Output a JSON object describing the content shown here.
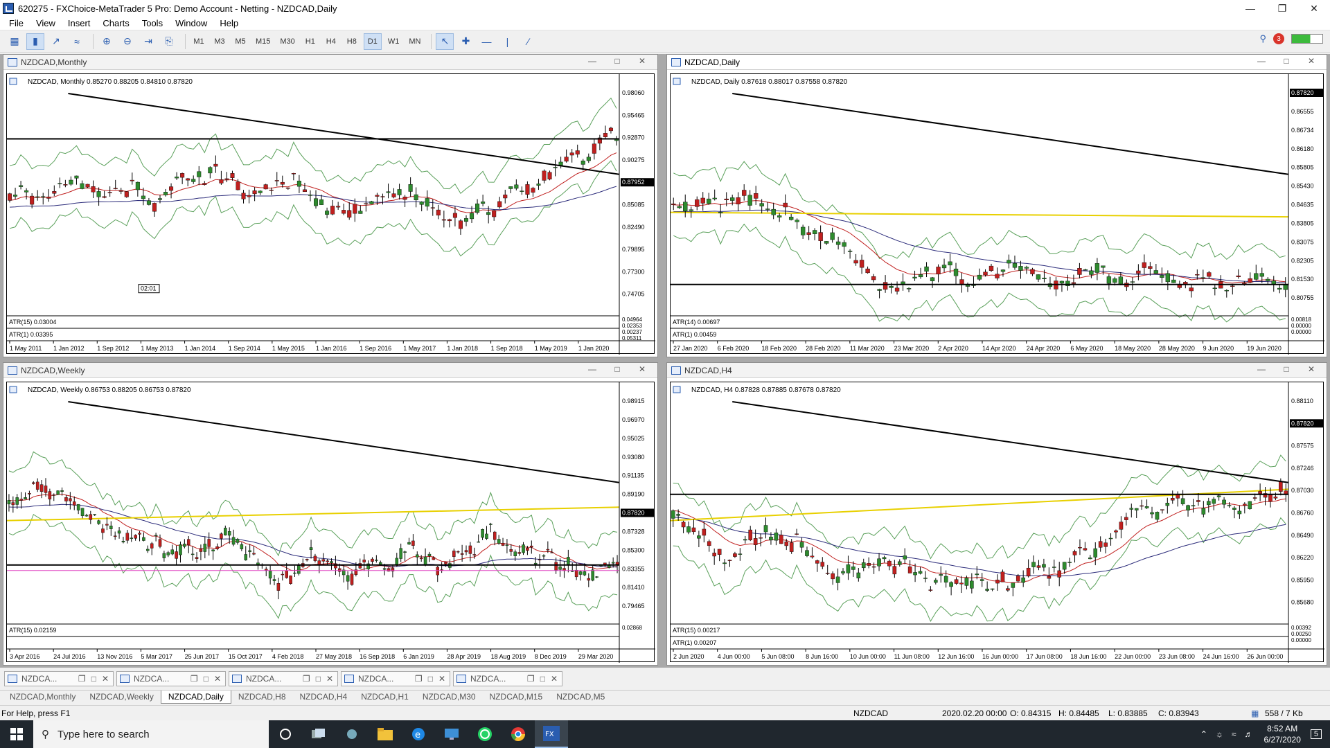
{
  "app": {
    "title": "620275 - FXChoice-MetaTrader 5 Pro: Demo Account - Netting - NZDCAD,Daily"
  },
  "menu": [
    "File",
    "View",
    "Insert",
    "Charts",
    "Tools",
    "Window",
    "Help"
  ],
  "timeframes": [
    "M1",
    "M3",
    "M5",
    "M15",
    "M30",
    "H1",
    "H4",
    "H8",
    "D1",
    "W1",
    "MN"
  ],
  "active_timeframe": "D1",
  "notifications": "3",
  "windows": [
    {
      "title": "NZDCAD,Monthly",
      "info": "NZDCAD, Monthly  0.85270 0.88205 0.84810 0.87820",
      "price_labels": [
        "0.98060",
        "0.95465",
        "0.92870",
        "0.90275",
        "0.87952",
        "0.85085",
        "0.82490",
        "0.79895",
        "0.77300",
        "0.74705"
      ],
      "current": "0.87952",
      "atr1": "ATR(15) 0.03004",
      "atr2": "ATR(1) 0.03395",
      "atr_labels": [
        "0.04964",
        "0.02353",
        "0.00237",
        "0.05311"
      ],
      "dates": [
        "1 May 2011",
        "1 Jan 2012",
        "1 Sep 2012",
        "1 May 2013",
        "1 Jan 2014",
        "1 Sep 2014",
        "1 May 2015",
        "1 Jan 2016",
        "1 Sep 2016",
        "1 May 2017",
        "1 Jan 2018",
        "1 Sep 2018",
        "1 May 2019",
        "1 Jan 2020"
      ],
      "timer": "02:01",
      "seed": 11,
      "n": 110
    },
    {
      "title": "NZDCAD,Daily",
      "info": "NZDCAD, Daily  0.87618 0.88017 0.87558 0.87820",
      "price_labels": [
        "0.87820",
        "0.86555",
        "0.86734",
        "0.86180",
        "0.85805",
        "0.85430",
        "0.84635",
        "0.83805",
        "0.83075",
        "0.82305",
        "0.81530",
        "0.80755"
      ],
      "current": "0.87820",
      "atr1": "ATR(14) 0.00697",
      "atr2": "ATR(1) 0.00459",
      "atr_labels": [
        "0.00818",
        "0.00000",
        "0.00000"
      ],
      "dates": [
        "27 Jan 2020",
        "6 Feb 2020",
        "18 Feb 2020",
        "28 Feb 2020",
        "11 Mar 2020",
        "23 Mar 2020",
        "2 Apr 2020",
        "14 Apr 2020",
        "24 Apr 2020",
        "6 May 2020",
        "18 May 2020",
        "28 May 2020",
        "9 Jun 2020",
        "19 Jun 2020"
      ],
      "seed": 23,
      "n": 105
    },
    {
      "title": "NZDCAD,Weekly",
      "info": "NZDCAD, Weekly  0.86753 0.88205 0.86753 0.87820",
      "price_labels": [
        "0.98915",
        "0.96970",
        "0.95025",
        "0.93080",
        "0.91135",
        "0.89190",
        "0.87820",
        "0.87328",
        "0.85300",
        "0.83355",
        "0.81410",
        "0.79465"
      ],
      "current": "0.87820",
      "atr1": "ATR(15) 0.02159",
      "atr2": "",
      "atr_labels": [
        "0.02868"
      ],
      "dates": [
        "3 Apr 2016",
        "24 Jul 2016",
        "13 Nov 2016",
        "5 Mar 2017",
        "25 Jun 2017",
        "15 Oct 2017",
        "4 Feb 2018",
        "27 May 2018",
        "16 Sep 2018",
        "6 Jan 2019",
        "28 Apr 2019",
        "18 Aug 2019",
        "8 Dec 2019",
        "29 Mar 2020"
      ],
      "seed": 37,
      "n": 150
    },
    {
      "title": "NZDCAD,H4",
      "info": "NZDCAD, H4  0.87828 0.87885 0.87678 0.87820",
      "price_labels": [
        "0.88110",
        "0.87820",
        "0.87575",
        "0.87246",
        "0.87030",
        "0.86760",
        "0.86490",
        "0.86220",
        "0.85950",
        "0.85680"
      ],
      "current": "0.87820",
      "atr1": "ATR(15) 0.00217",
      "atr2": "ATR(1) 0.00207",
      "atr_labels": [
        "0.00392",
        "0.00250",
        "0.00000"
      ],
      "dates": [
        "2 Jun 2020",
        "4 Jun 00:00",
        "5 Jun 08:00",
        "8 Jun 16:00",
        "10 Jun 00:00",
        "11 Jun 08:00",
        "12 Jun 16:00",
        "16 Jun 00:00",
        "17 Jun 08:00",
        "18 Jun 16:00",
        "22 Jun 00:00",
        "23 Jun 08:00",
        "24 Jun 16:00",
        "26 Jun 00:00"
      ],
      "seed": 53,
      "n": 120
    }
  ],
  "bottom_windows": [
    "NZDCA...",
    "NZDCA...",
    "NZDCA...",
    "NZDCA...",
    "NZDCA..."
  ],
  "tabs": [
    "NZDCAD,Monthly",
    "NZDCAD,Weekly",
    "NZDCAD,Daily",
    "NZDCAD,H8",
    "NZDCAD,H4",
    "NZDCAD,H1",
    "NZDCAD,M30",
    "NZDCAD,M15",
    "NZDCAD,M5"
  ],
  "selected_tab": "NZDCAD,Daily",
  "status": {
    "help": "For Help, press F1",
    "symbol": "NZDCAD",
    "time": "2020.02.20 00:00",
    "open": "O: 0.84315",
    "high": "H: 0.84485",
    "low": "L: 0.83885",
    "close": "C: 0.83943",
    "traffic": "558 / 7 Kb"
  },
  "taskbar": {
    "search": "Type here to search",
    "time": "8:52 AM",
    "date": "6/27/2020",
    "notif": "5"
  },
  "colors": {
    "bull": "#2e8b2e",
    "bear": "#c0201f",
    "band": "#5aa05a",
    "ma_fast": "#c0201f",
    "ma_slow": "#2b2b7a",
    "ma_yellow": "#e8d000",
    "pink": "#e040c0",
    "accent": "#2a5db0"
  }
}
